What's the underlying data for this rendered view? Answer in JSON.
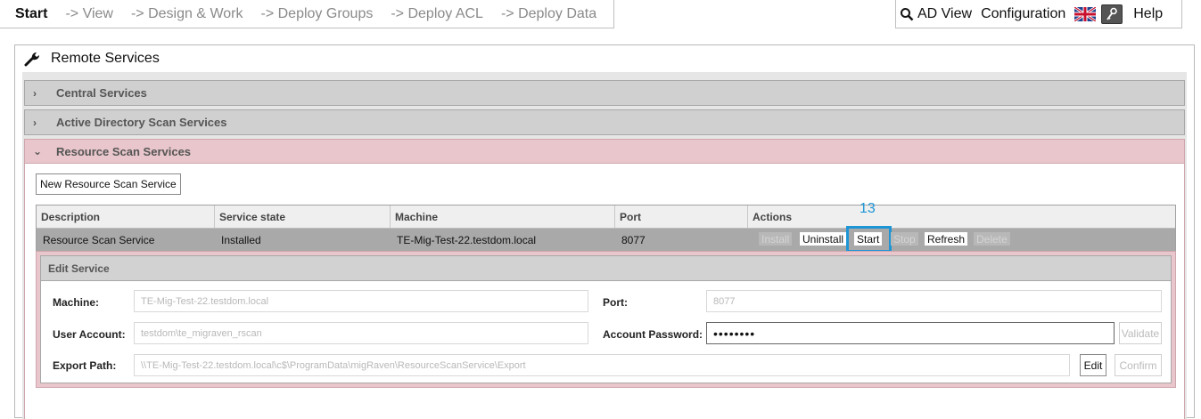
{
  "nav": {
    "steps": [
      "Start",
      "-> View",
      "-> Design & Work",
      "-> Deploy Groups",
      "-> Deploy ACL",
      "-> Deploy Data"
    ]
  },
  "topright": {
    "ad_view": "AD View",
    "configuration": "Configuration",
    "help": "Help"
  },
  "panel": {
    "title": "Remote Services",
    "sections": [
      "Central Services",
      "Active Directory Scan Services",
      "Resource Scan Services"
    ]
  },
  "resource": {
    "new_button": "New Resource Scan Service",
    "columns": [
      "Description",
      "Service state",
      "Machine",
      "Port",
      "Actions"
    ],
    "row": {
      "description": "Resource Scan Service",
      "state": "Installed",
      "machine": "TE-Mig-Test-22.testdom.local",
      "port": "8077"
    },
    "actions": {
      "install": "Install",
      "uninstall": "Uninstall",
      "start": "Start",
      "stop": "Stop",
      "refresh": "Refresh",
      "delete": "Delete"
    },
    "step_badge": "13"
  },
  "edit": {
    "title": "Edit Service",
    "machine_label": "Machine:",
    "machine_value": "TE-Mig-Test-22.testdom.local",
    "port_label": "Port:",
    "port_value": "8077",
    "user_label": "User Account:",
    "user_value": "testdom\\te_migraven_rscan",
    "password_label": "Account Password:",
    "password_value": "••••••••",
    "validate": "Validate",
    "export_label": "Export Path:",
    "export_value": "\\\\TE-Mig-Test-22.testdom.local\\c$\\ProgramData\\migRaven\\ResourceScanService\\Export",
    "edit_button": "Edit",
    "confirm_button": "Confirm"
  },
  "colors": {
    "accent_highlight": "#1e96d6",
    "section_open": "#e8c6cb",
    "row_selected": "#a9a9a9"
  }
}
